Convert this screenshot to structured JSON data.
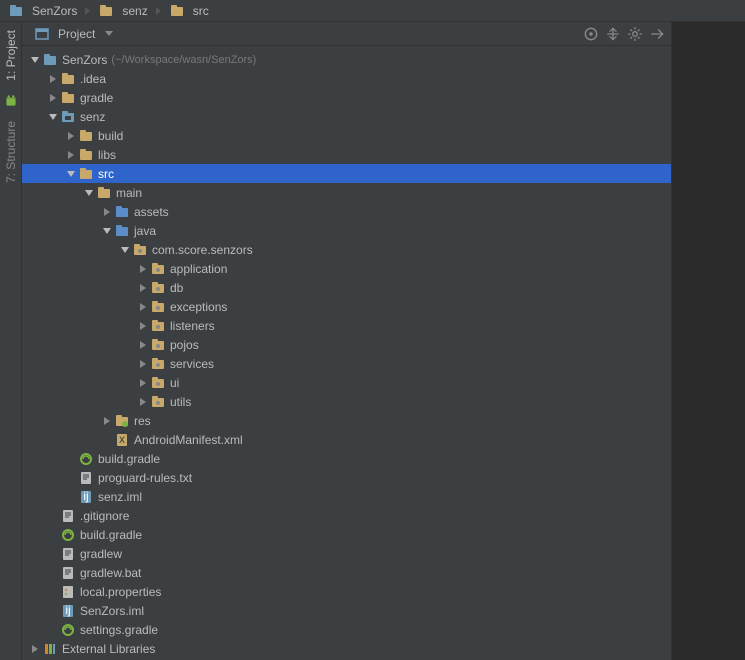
{
  "breadcrumbs": [
    {
      "label": "SenZors",
      "icon": "module"
    },
    {
      "label": "senz",
      "icon": "folder"
    },
    {
      "label": "src",
      "icon": "folder"
    }
  ],
  "sidebar_tabs": [
    {
      "label": "1: Project",
      "icon": "project",
      "active": true
    },
    {
      "label": "7: Structure",
      "icon": "structure",
      "active": false
    }
  ],
  "panel": {
    "title": "Project",
    "tools": [
      "target-icon",
      "collapse-icon",
      "gear-icon",
      "hide-icon"
    ]
  },
  "tree": [
    {
      "depth": 0,
      "exp": "open",
      "icon": "module",
      "label": "SenZors",
      "hint": "(~/Workspace/wasn/SenZors)",
      "name": "root-project"
    },
    {
      "depth": 1,
      "exp": "closed",
      "icon": "folder",
      "label": ".idea",
      "name": "folder-idea"
    },
    {
      "depth": 1,
      "exp": "closed",
      "icon": "folder",
      "label": "gradle",
      "name": "folder-gradle"
    },
    {
      "depth": 1,
      "exp": "open",
      "icon": "module-folder",
      "label": "senz",
      "name": "module-senz"
    },
    {
      "depth": 2,
      "exp": "closed",
      "icon": "folder",
      "label": "build",
      "name": "folder-build"
    },
    {
      "depth": 2,
      "exp": "closed",
      "icon": "folder",
      "label": "libs",
      "name": "folder-libs"
    },
    {
      "depth": 2,
      "exp": "open",
      "icon": "folder",
      "label": "src",
      "name": "folder-src",
      "selected": true
    },
    {
      "depth": 3,
      "exp": "open",
      "icon": "folder",
      "label": "main",
      "name": "folder-main"
    },
    {
      "depth": 4,
      "exp": "closed",
      "icon": "src-folder",
      "label": "assets",
      "name": "folder-assets"
    },
    {
      "depth": 4,
      "exp": "open",
      "icon": "src-folder",
      "label": "java",
      "name": "folder-java"
    },
    {
      "depth": 5,
      "exp": "open",
      "icon": "package",
      "label": "com.score.senzors",
      "name": "pkg-root"
    },
    {
      "depth": 6,
      "exp": "closed",
      "icon": "package",
      "label": "application",
      "name": "pkg-application"
    },
    {
      "depth": 6,
      "exp": "closed",
      "icon": "package",
      "label": "db",
      "name": "pkg-db"
    },
    {
      "depth": 6,
      "exp": "closed",
      "icon": "package",
      "label": "exceptions",
      "name": "pkg-exceptions"
    },
    {
      "depth": 6,
      "exp": "closed",
      "icon": "package",
      "label": "listeners",
      "name": "pkg-listeners"
    },
    {
      "depth": 6,
      "exp": "closed",
      "icon": "package",
      "label": "pojos",
      "name": "pkg-pojos"
    },
    {
      "depth": 6,
      "exp": "closed",
      "icon": "package",
      "label": "services",
      "name": "pkg-services"
    },
    {
      "depth": 6,
      "exp": "closed",
      "icon": "package",
      "label": "ui",
      "name": "pkg-ui"
    },
    {
      "depth": 6,
      "exp": "closed",
      "icon": "package",
      "label": "utils",
      "name": "pkg-utils"
    },
    {
      "depth": 4,
      "exp": "closed",
      "icon": "res-folder",
      "label": "res",
      "name": "folder-res"
    },
    {
      "depth": 4,
      "exp": "none",
      "icon": "xml",
      "label": "AndroidManifest.xml",
      "name": "file-manifest"
    },
    {
      "depth": 2,
      "exp": "none",
      "icon": "gradle",
      "label": "build.gradle",
      "name": "file-build-gradle-module"
    },
    {
      "depth": 2,
      "exp": "none",
      "icon": "text",
      "label": "proguard-rules.txt",
      "name": "file-proguard"
    },
    {
      "depth": 2,
      "exp": "none",
      "icon": "iml",
      "label": "senz.iml",
      "name": "file-senz-iml"
    },
    {
      "depth": 1,
      "exp": "none",
      "icon": "text",
      "label": ".gitignore",
      "name": "file-gitignore"
    },
    {
      "depth": 1,
      "exp": "none",
      "icon": "gradle",
      "label": "build.gradle",
      "name": "file-build-gradle-root"
    },
    {
      "depth": 1,
      "exp": "none",
      "icon": "text",
      "label": "gradlew",
      "name": "file-gradlew"
    },
    {
      "depth": 1,
      "exp": "none",
      "icon": "text",
      "label": "gradlew.bat",
      "name": "file-gradlew-bat"
    },
    {
      "depth": 1,
      "exp": "none",
      "icon": "props",
      "label": "local.properties",
      "name": "file-local-props"
    },
    {
      "depth": 1,
      "exp": "none",
      "icon": "iml",
      "label": "SenZors.iml",
      "name": "file-senzors-iml"
    },
    {
      "depth": 1,
      "exp": "none",
      "icon": "gradle",
      "label": "settings.gradle",
      "name": "file-settings-gradle"
    },
    {
      "depth": 0,
      "exp": "closed",
      "icon": "libs",
      "label": "External Libraries",
      "name": "external-libraries"
    }
  ]
}
